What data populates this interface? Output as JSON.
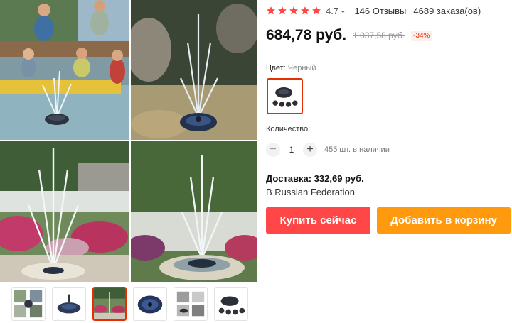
{
  "product": {
    "rating": "4.7",
    "stars_filled": 5,
    "reviews": "146 Отзывы",
    "orders": "4689 заказа(ов)"
  },
  "price": {
    "current": "684,78 руб.",
    "old": "1 037,58 руб.",
    "discount": "-34%"
  },
  "color": {
    "label": "Цвет:",
    "value": "Черный"
  },
  "quantity": {
    "label": "Количество:",
    "minus": "−",
    "value": "1",
    "plus": "+",
    "stock": "455 шт. в наличии"
  },
  "delivery": {
    "cost": "Доставка: 332,69 руб.",
    "destination": "В Russian Federation"
  },
  "buttons": {
    "buy_now": "Купить сейчас",
    "add_to_cart": "Добавить в корзину"
  },
  "gallery": {
    "thumbnail_count": 6,
    "active_thumbnail": 3
  },
  "colors": {
    "accent": "#e62e04",
    "buy_button": "#ff4747",
    "cart_button": "#ff9a0e",
    "star": "#ff4747"
  }
}
